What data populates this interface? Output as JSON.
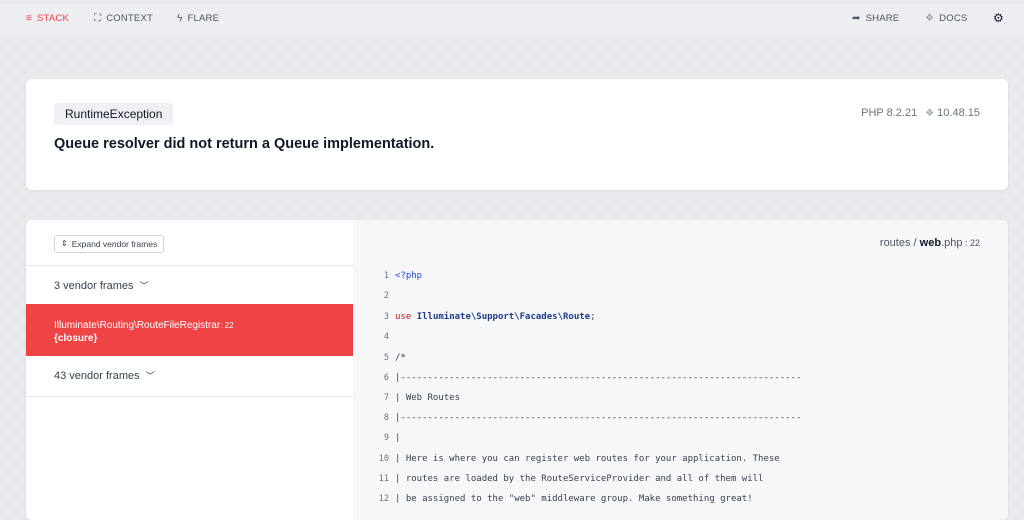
{
  "topbar": {
    "stack_label": "STACK",
    "context_label": "CONTEXT",
    "flare_label": "FLARE",
    "share_label": "SHARE",
    "docs_label": "DOCS",
    "accent_color": "#ef4444"
  },
  "header": {
    "exception_class": "RuntimeException",
    "message": "Queue resolver did not return a Queue implementation.",
    "php_version": "PHP 8.2.21",
    "laravel_version": "10.48.15"
  },
  "stack": {
    "expand_label": "Expand vendor frames",
    "vendor_group_1": "3 vendor frames",
    "active_frame": {
      "class": "Illuminate\\Routing\\RouteFileRegistrar",
      "line": ": 22",
      "function": "{closure}"
    },
    "vendor_group_2": "43 vendor frames"
  },
  "code": {
    "file_dir": "routes / ",
    "file_name": "web",
    "file_ext": ".php",
    "file_line": " : 22",
    "lines": [
      {
        "n": "1",
        "text": "<?php"
      },
      {
        "n": "2",
        "text": ""
      },
      {
        "n": "3",
        "kw": "use ",
        "ns": "Illuminate\\Support\\Facades\\Route",
        "rest": ";"
      },
      {
        "n": "4",
        "text": ""
      },
      {
        "n": "5",
        "text": "/*"
      },
      {
        "n": "6",
        "text": "|--------------------------------------------------------------------------"
      },
      {
        "n": "7",
        "text": "| Web Routes"
      },
      {
        "n": "8",
        "text": "|--------------------------------------------------------------------------"
      },
      {
        "n": "9",
        "text": "|"
      },
      {
        "n": "10",
        "text": "| Here is where you can register web routes for your application. These"
      },
      {
        "n": "11",
        "text": "| routes are loaded by the RouteServiceProvider and all of them will"
      },
      {
        "n": "12",
        "text": "| be assigned to the \"web\" middleware group. Make something great!"
      }
    ]
  }
}
